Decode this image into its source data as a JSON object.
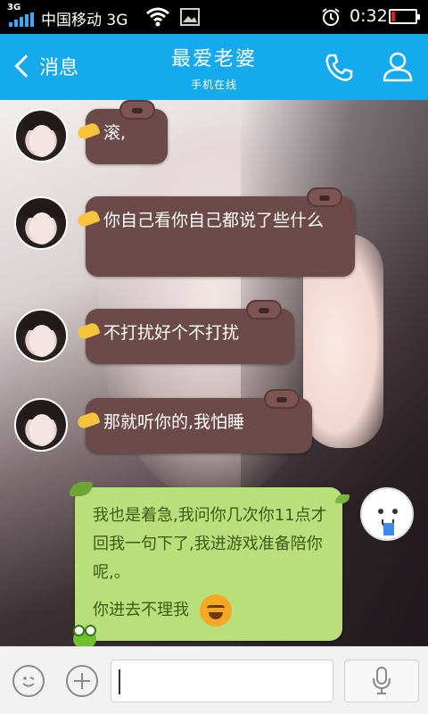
{
  "status_bar": {
    "network_type": "3G",
    "carrier": "中国移动 3G",
    "time": "0:32",
    "battery_level": 0.15,
    "icons": [
      "signal-icon",
      "wifi-icon",
      "image-icon",
      "alarm-icon",
      "battery-icon"
    ]
  },
  "header": {
    "back_label": "消息",
    "title": "最爱老婆",
    "subtitle": "手机在线",
    "background_color": "#15a9ee",
    "icons": [
      "back-chevron-icon",
      "phone-call-icon",
      "profile-icon"
    ]
  },
  "messages": [
    {
      "sender": "contact",
      "text": "滚,"
    },
    {
      "sender": "contact",
      "text": "你自己看你自己都说了些什么"
    },
    {
      "sender": "contact",
      "text": "不打扰好个不打扰"
    },
    {
      "sender": "contact",
      "text": "那就听你的,我怕睡"
    },
    {
      "sender": "me",
      "text": "我也是着急,我问你几次你11点才回我一句下了,我进游戏准备陪你呢,。",
      "text2": "你进去不理我",
      "emoji": "laughing-crying-emoji"
    }
  ],
  "colors": {
    "contact_bubble": "#6b4a49",
    "my_bubble": "#b8df7a"
  },
  "input_bar": {
    "text_value": "",
    "icons": [
      "emoji-icon",
      "plus-icon",
      "microphone-icon"
    ]
  }
}
